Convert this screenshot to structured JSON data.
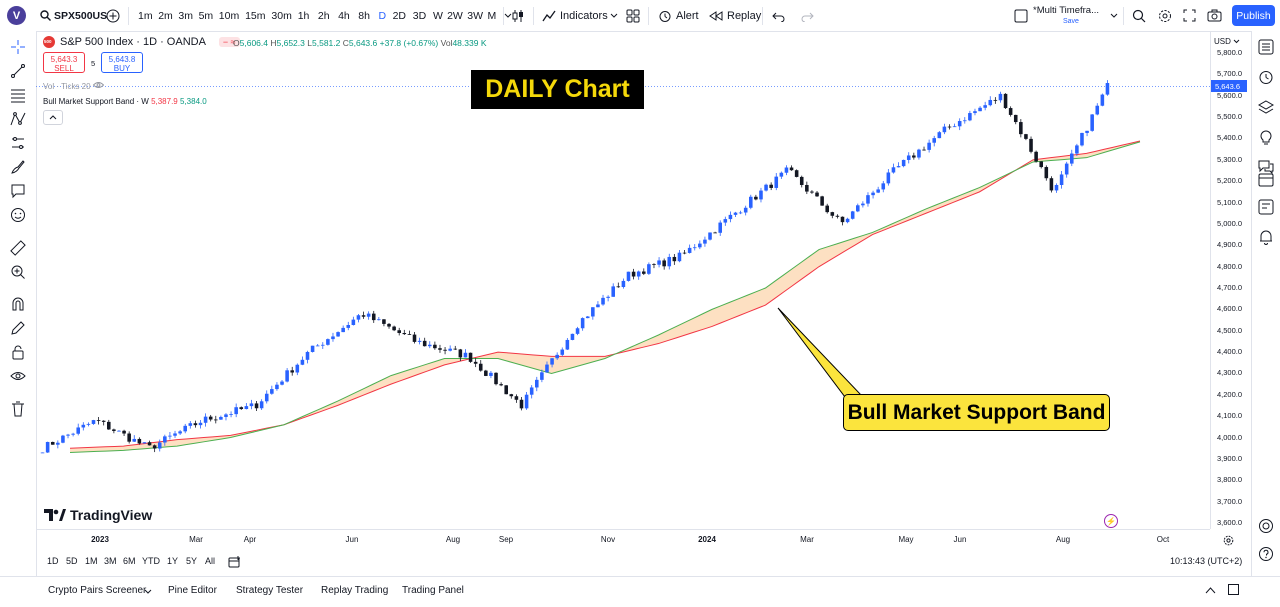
{
  "topbar": {
    "avatar": "V",
    "symbol": "SPX500US",
    "intervals": [
      "1m",
      "2m",
      "3m",
      "5m",
      "10m",
      "15m",
      "30m",
      "1h",
      "2h",
      "4h",
      "8h",
      "D",
      "2D",
      "3D",
      "W",
      "2W",
      "3W",
      "M"
    ],
    "active_interval": "D",
    "indicators": "Indicators",
    "alert": "Alert",
    "replay": "Replay",
    "multi_timeframe": "*Multi Timefra...",
    "save": "Save",
    "publish": "Publish"
  },
  "legend": {
    "badge": "500",
    "title": "S&P 500 Index · 1D · OANDA",
    "o_label": "O",
    "o": "5,606.4",
    "h_label": "H",
    "h": "5,652.3",
    "l_label": "L",
    "l": "5,581.2",
    "c_label": "C",
    "c": "5,643.6",
    "chg": "+37.8 (+0.67%)",
    "vol_label": "Vol",
    "vol": "48.339 K",
    "sell_price": "5,643.3",
    "sell": "SELL",
    "spread": "5",
    "buy_price": "5,643.8",
    "buy": "BUY",
    "vol_ticks": "Vol · Ticks 20",
    "bmsb_label": "Bull Market Support Band · W",
    "bmsb_red": "5,387.9",
    "bmsb_green": "5,384.0"
  },
  "annotations": {
    "daily": "DAILY Chart",
    "bmsb": "Bull Market Support Band"
  },
  "branding": {
    "logo": "TradingView"
  },
  "price_scale": {
    "currency": "USD",
    "ticks": [
      "5,800.0",
      "5,700.0",
      "5,600.0",
      "5,500.0",
      "5,400.0",
      "5,300.0",
      "5,200.0",
      "5,100.0",
      "5,000.0",
      "4,900.0",
      "4,800.0",
      "4,700.0",
      "4,600.0",
      "4,500.0",
      "4,400.0",
      "4,300.0",
      "4,200.0",
      "4,100.0",
      "4,000.0",
      "3,900.0",
      "3,800.0",
      "3,700.0",
      "3,600.0"
    ],
    "current": "5,643.6"
  },
  "time_axis": {
    "labels": [
      "2023",
      "Mar",
      "Apr",
      "Jun",
      "Aug",
      "Sep",
      "Nov",
      "2024",
      "Mar",
      "May",
      "Jun",
      "Aug",
      "Oct"
    ],
    "clock": "10:13:43 (UTC+2)"
  },
  "ranges": [
    "1D",
    "5D",
    "1M",
    "3M",
    "6M",
    "YTD",
    "1Y",
    "5Y",
    "All"
  ],
  "bottom_tabs": [
    "Crypto Pairs Screener",
    "Pine Editor",
    "Strategy Tester",
    "Replay Trading",
    "Trading Panel"
  ],
  "colors": {
    "up": "#2962ff",
    "down": "#131722",
    "band_red": "#f23645",
    "band_green": "#4caf50",
    "band_fill": "#fde0c2",
    "annotation_fill": "#fbe43d"
  },
  "chart_data": {
    "type": "candlestick",
    "y_range": [
      3600,
      5800
    ],
    "x": [
      "2023-01",
      "2023-02",
      "2023-03",
      "2023-04",
      "2023-05",
      "2023-06",
      "2023-07",
      "2023-08",
      "2023-09",
      "2023-10",
      "2023-11",
      "2023-12",
      "2024-01",
      "2024-02",
      "2024-03",
      "2024-04",
      "2024-05",
      "2024-06",
      "2024-07",
      "2024-08",
      "2024-09"
    ],
    "close_approx": [
      3950,
      4080,
      3950,
      4080,
      4150,
      4400,
      4580,
      4450,
      4380,
      4150,
      4520,
      4760,
      4850,
      5050,
      5250,
      5000,
      5250,
      5450,
      5600,
      5150,
      5643.6
    ],
    "band_red": [
      3950,
      3960,
      3990,
      4010,
      4060,
      4150,
      4250,
      4340,
      4400,
      4380,
      4380,
      4440,
      4520,
      4620,
      4800,
      4950,
      5050,
      5150,
      5300,
      5330,
      5387.9
    ],
    "band_green": [
      3930,
      3940,
      3960,
      4000,
      4060,
      4170,
      4290,
      4370,
      4370,
      4300,
      4370,
      4480,
      4600,
      4700,
      4880,
      4960,
      5070,
      5170,
      5290,
      5310,
      5384.0
    ]
  }
}
